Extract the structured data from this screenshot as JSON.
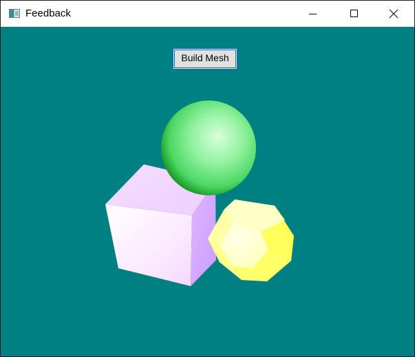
{
  "window": {
    "title": "Feedback",
    "icon": "app-window-icon",
    "controls": [
      "minimize-icon",
      "maximize-icon",
      "close-icon"
    ]
  },
  "client": {
    "background_color": "#008080",
    "build_button_label": "Build Mesh"
  },
  "scene": {
    "objects": [
      {
        "shape": "sphere",
        "color": "#7fef8f"
      },
      {
        "shape": "cube",
        "color": "#f2dcff"
      },
      {
        "shape": "dodecahedron",
        "color": "#ffff88"
      }
    ]
  }
}
